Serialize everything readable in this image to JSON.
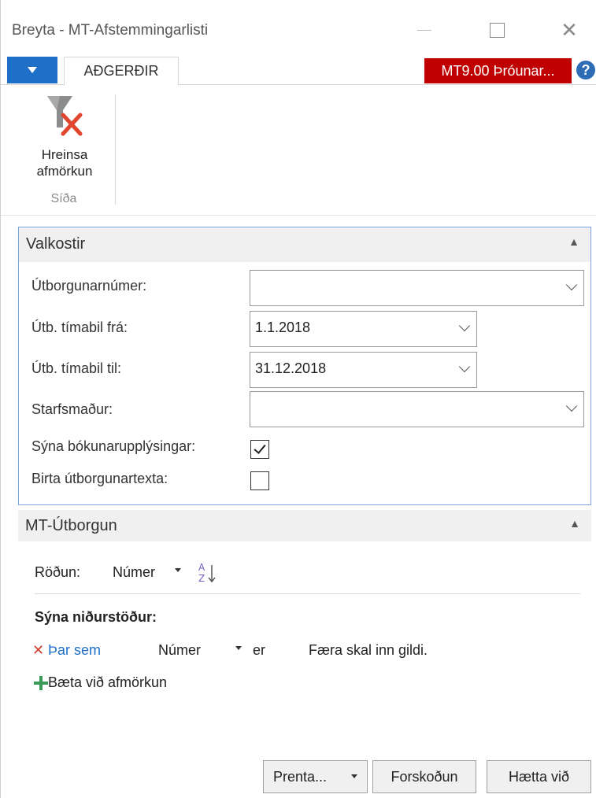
{
  "window": {
    "title": "Breyta - MT-Afstemmingarlisti"
  },
  "ribbon": {
    "tab_actions": "AÐGERÐIR",
    "company_badge": "MT9.00 Þróunar...",
    "help_glyph": "?",
    "clear_filter_line1": "Hreinsa",
    "clear_filter_line2": "afmörkun",
    "group_label": "Síða"
  },
  "options": {
    "header": "Valkostir",
    "fields": [
      {
        "label": "Útborgunarnúmer:",
        "value": ""
      },
      {
        "label": "Útb. tímabil frá:",
        "value": "1.1.2018"
      },
      {
        "label": "Útb. tímabil til:",
        "value": "31.12.2018"
      },
      {
        "label": "Starfsmaður:",
        "value": ""
      }
    ],
    "checkboxes": [
      {
        "label": "Sýna bókunarupplýsingar:",
        "checked": true
      },
      {
        "label": "Birta útborgunartexta:",
        "checked": false
      }
    ]
  },
  "table_section": {
    "header": "MT-Útborgun",
    "sort_label": "Röðun:",
    "sort_field": "Númer",
    "results_title": "Sýna niðurstöður:",
    "filter": {
      "where": "Þar sem",
      "field": "Númer",
      "operator": "er",
      "value": "Færa skal inn gildi."
    },
    "add_filter": "Bæta við afmörkun"
  },
  "buttons": {
    "print": "Prenta...",
    "preview": "Forskoðun",
    "cancel": "Hætta við"
  },
  "colors": {
    "accent": "#1e6fc8",
    "badge": "#c00000",
    "panel_border": "#7aa7e0"
  }
}
